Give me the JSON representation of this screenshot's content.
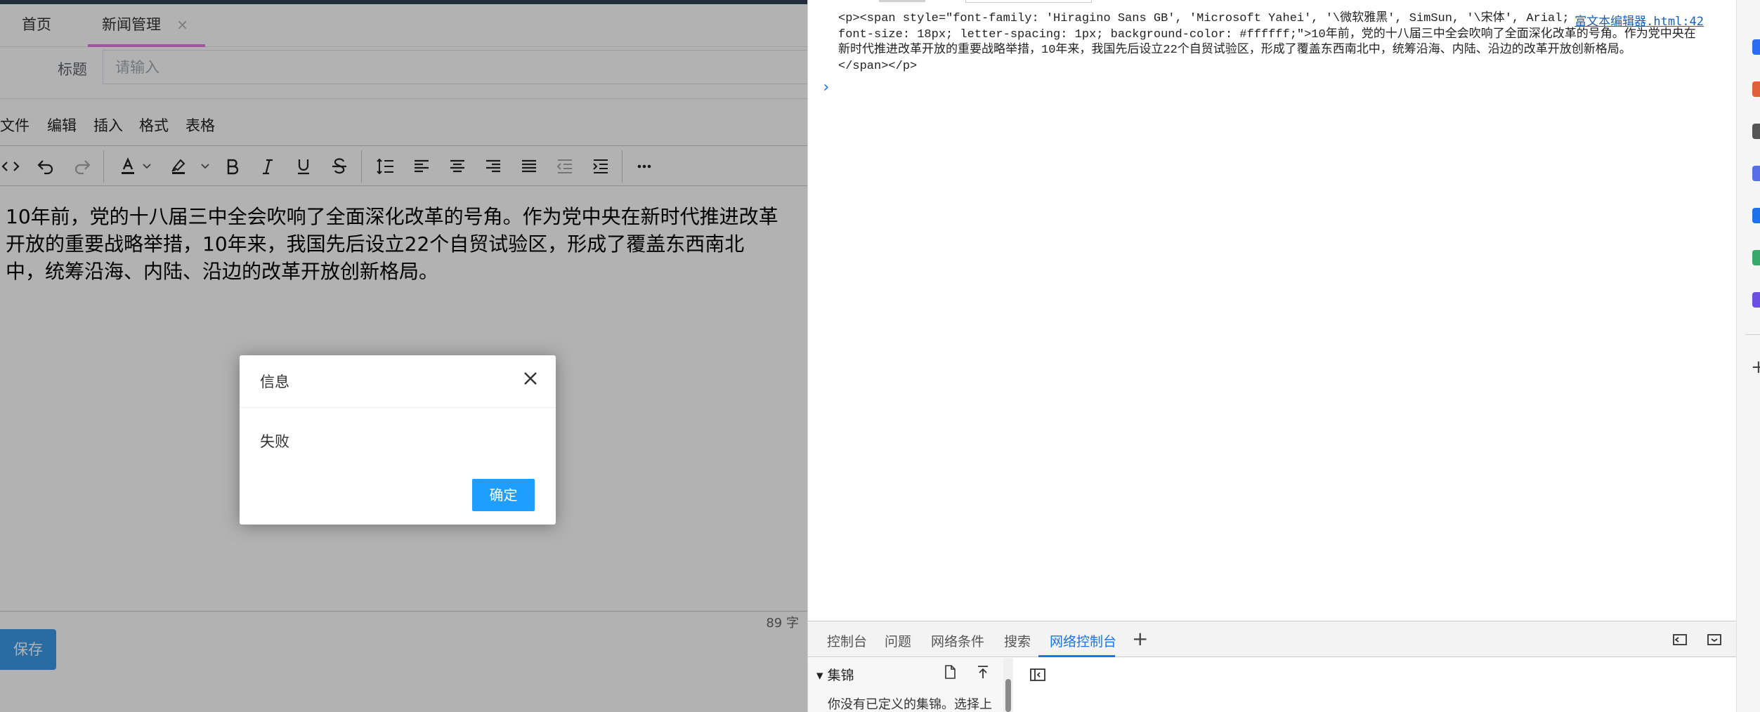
{
  "tabs": [
    {
      "label": "首页"
    },
    {
      "label": "新闻管理",
      "close": "×"
    }
  ],
  "form": {
    "title_label": "标题",
    "title_placeholder": "请输入"
  },
  "editor": {
    "menus": [
      "文件",
      "编辑",
      "插入",
      "格式",
      "表格"
    ],
    "toolbar_icons": [
      "source-code-icon",
      "undo-icon",
      "redo-icon",
      "text-color-icon",
      "highlight-color-icon",
      "bold-icon",
      "italic-icon",
      "underline-icon",
      "strikethrough-icon",
      "line-height-icon",
      "align-left-icon",
      "align-center-icon",
      "align-right-icon",
      "align-justify-icon",
      "outdent-icon",
      "indent-icon",
      "more-icon"
    ],
    "content": "10年前，党的十八届三中全会吹响了全面深化改革的号角。作为党中央在新时代推进改革开放的重要战略举措，10年来，我国先后设立22个自贸试验区，形成了覆盖东西南北中，统筹沿海、内陆、沿边的改革开放创新格局。",
    "word_count": "89 字"
  },
  "save_label": "保存",
  "dialog": {
    "title": "信息",
    "message": "失败",
    "ok_label": "确定"
  },
  "devtools": {
    "console_output": "<p><span style=\"font-family: 'Hiragino Sans GB', 'Microsoft Yahei', '\\微软雅黑', SimSun, '\\宋体', Arial;\nfont-size: 18px; letter-spacing: 1px; background-color: #ffffff;\">10年前，党的十八届三中全会吹响了全面深化改革的号角。作为党中央在\n新时代推进改革开放的重要战略举措，10年来，我国先后设立22个自贸试验区，形成了覆盖东西南北中，统筹沿海、内陆、沿边的改革开放创新格局。\n</span></p>",
    "console_source": "富文本编辑器.html:42",
    "prompt": "›",
    "drawer_tabs": [
      "控制台",
      "问题",
      "网络条件",
      "搜索",
      "网络控制台"
    ],
    "active_tab": "网络控制台",
    "snippets_header": "集锦",
    "snippets_empty": "你没有已定义的集锦。选择上",
    "colors": {
      "accent": "#1a73e8",
      "dialog_button": "#1e9fff",
      "save_button": "#3a9bea",
      "tab_underline": "#e879e6"
    }
  }
}
